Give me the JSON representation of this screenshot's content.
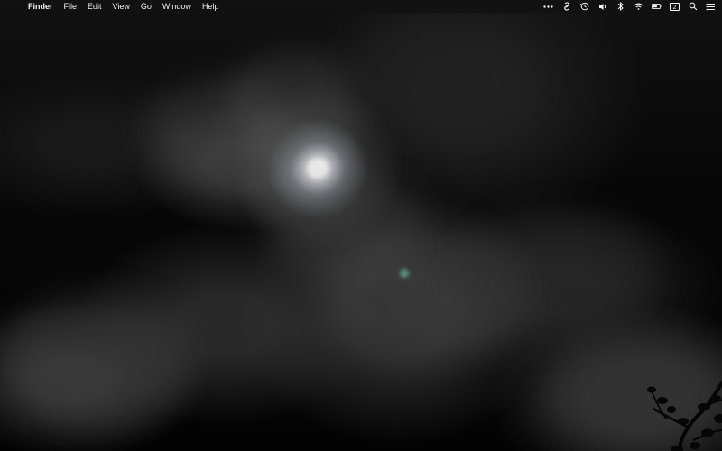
{
  "menubar": {
    "apple_icon": "",
    "app_name": "Finder",
    "items": [
      "File",
      "Edit",
      "View",
      "Go",
      "Window",
      "Help"
    ],
    "status_icons": [
      "more-icon",
      "sync-icon",
      "time-machine-icon",
      "volume-icon",
      "bluetooth-icon",
      "wifi-icon",
      "battery-icon",
      "date-badge-icon",
      "search-icon",
      "notification-center-icon"
    ],
    "date_badge": "2"
  },
  "desktop": {
    "wallpaper": "night-clouds-moon",
    "accent_colors": {
      "sky": "#050505",
      "cloud": "#666666",
      "moon": "#ffffff",
      "glow": "#dfe7ff",
      "sparkle": "#5fd2aa"
    }
  }
}
